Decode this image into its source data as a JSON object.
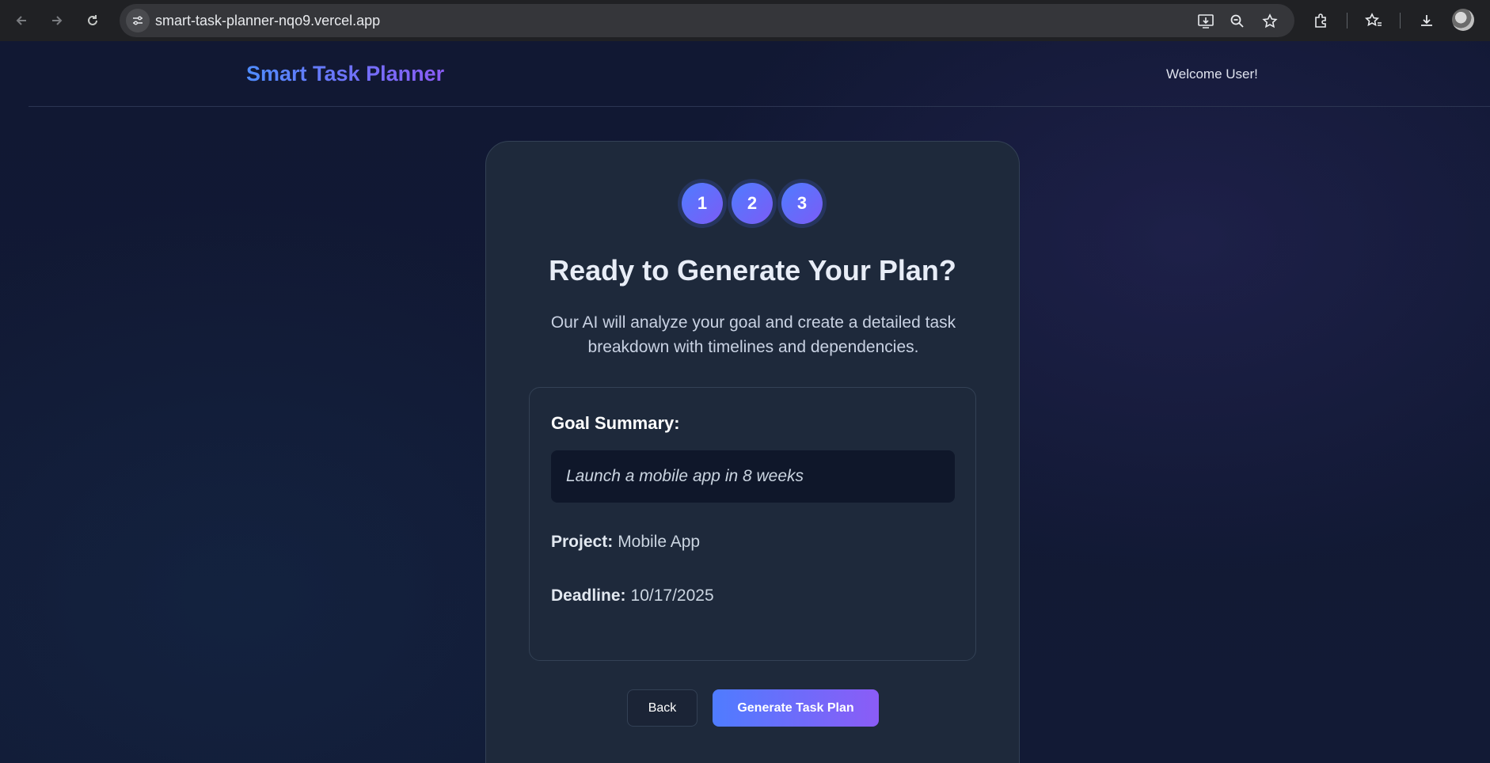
{
  "browser": {
    "url": "smart-task-planner-nqo9.vercel.app",
    "icons": [
      "back-icon",
      "forward-icon",
      "reload-icon",
      "site-info-icon",
      "install-app-icon",
      "zoom-icon",
      "bookmark-star-icon",
      "extensions-icon",
      "favorites-icon",
      "downloads-icon",
      "profile-avatar"
    ]
  },
  "header": {
    "brand": "Smart Task Planner",
    "welcome": "Welcome User!"
  },
  "wizard": {
    "steps": [
      "1",
      "2",
      "3"
    ],
    "title": "Ready to Generate Your Plan?",
    "description": "Our AI will analyze your goal and create a detailed task breakdown with timelines and dependencies.",
    "summary": {
      "heading": "Goal Summary:",
      "goal": "Launch a mobile app in 8 weeks",
      "project_label": "Project:",
      "project_value": "Mobile App",
      "deadline_label": "Deadline:",
      "deadline_value": "10/17/2025"
    },
    "back_label": "Back",
    "generate_label": "Generate Task Plan"
  },
  "colors": {
    "accent_start": "#4f7cff",
    "accent_end": "#8b5cf6",
    "card_bg": "#1e293b",
    "page_bg": "#121a33"
  }
}
